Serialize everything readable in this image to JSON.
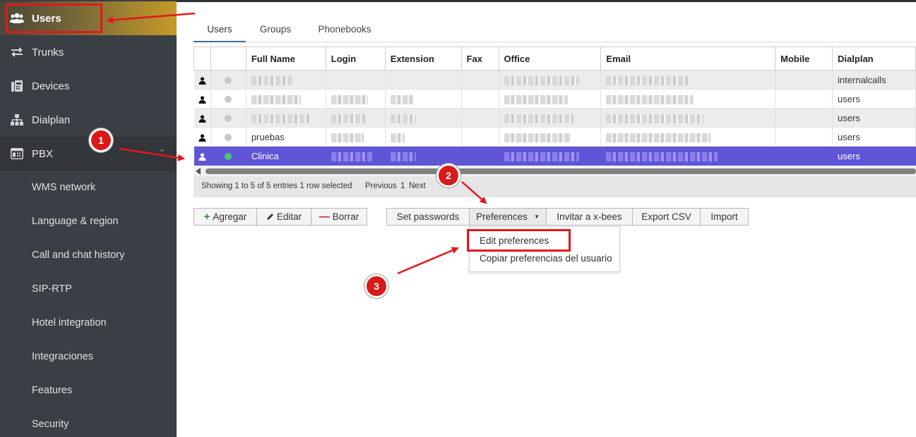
{
  "sidebar": {
    "items": [
      {
        "label": "Users",
        "icon": "users-icon"
      },
      {
        "label": "Trunks",
        "icon": "arrows-exchange-icon"
      },
      {
        "label": "Devices",
        "icon": "fax-device-icon"
      },
      {
        "label": "Dialplan",
        "icon": "sitemap-icon"
      },
      {
        "label": "PBX",
        "icon": "phone-box-icon"
      }
    ],
    "pbx_children": [
      "WMS network",
      "Language & region",
      "Call and chat history",
      "SIP-RTP",
      "Hotel integration",
      "Integraciones",
      "Features",
      "Security"
    ]
  },
  "tabs": [
    "Users",
    "Groups",
    "Phonebooks"
  ],
  "table": {
    "columns": [
      "",
      "",
      "Full Name",
      "Login",
      "Extension",
      "Fax",
      "Office",
      "Email",
      "Mobile",
      "Dialplan"
    ],
    "rows": [
      {
        "full_name": "",
        "dialplan": "internalcalls",
        "status": "offline"
      },
      {
        "full_name": "",
        "dialplan": "users",
        "status": "offline"
      },
      {
        "full_name": "",
        "dialplan": "users",
        "status": "offline"
      },
      {
        "full_name": "pruebas",
        "dialplan": "users",
        "status": "offline"
      },
      {
        "full_name": "Clinica",
        "dialplan": "users",
        "status": "online",
        "selected": true
      }
    ]
  },
  "footer": {
    "info": "Showing 1 to 5 of 5 entries 1 row selected",
    "previous": "Previous",
    "page": "1",
    "next": "Next"
  },
  "toolbar": {
    "add": "Agregar",
    "edit": "Editar",
    "delete": "Borrar",
    "set_passwords": "Set passwords",
    "preferences": "Preferences",
    "invite": "Invitar a x-bees",
    "export": "Export CSV",
    "import": "Import"
  },
  "preferences_menu": [
    "Edit preferences",
    "Copiar preferencias del usuario"
  ],
  "annotations": {
    "step1": "1",
    "step2": "2",
    "step3": "3"
  },
  "colors": {
    "sidebar": "#3a3f45",
    "active_gold": "#c69a28",
    "selected_row": "#5f55d6",
    "annotation_red": "#e3171b"
  }
}
